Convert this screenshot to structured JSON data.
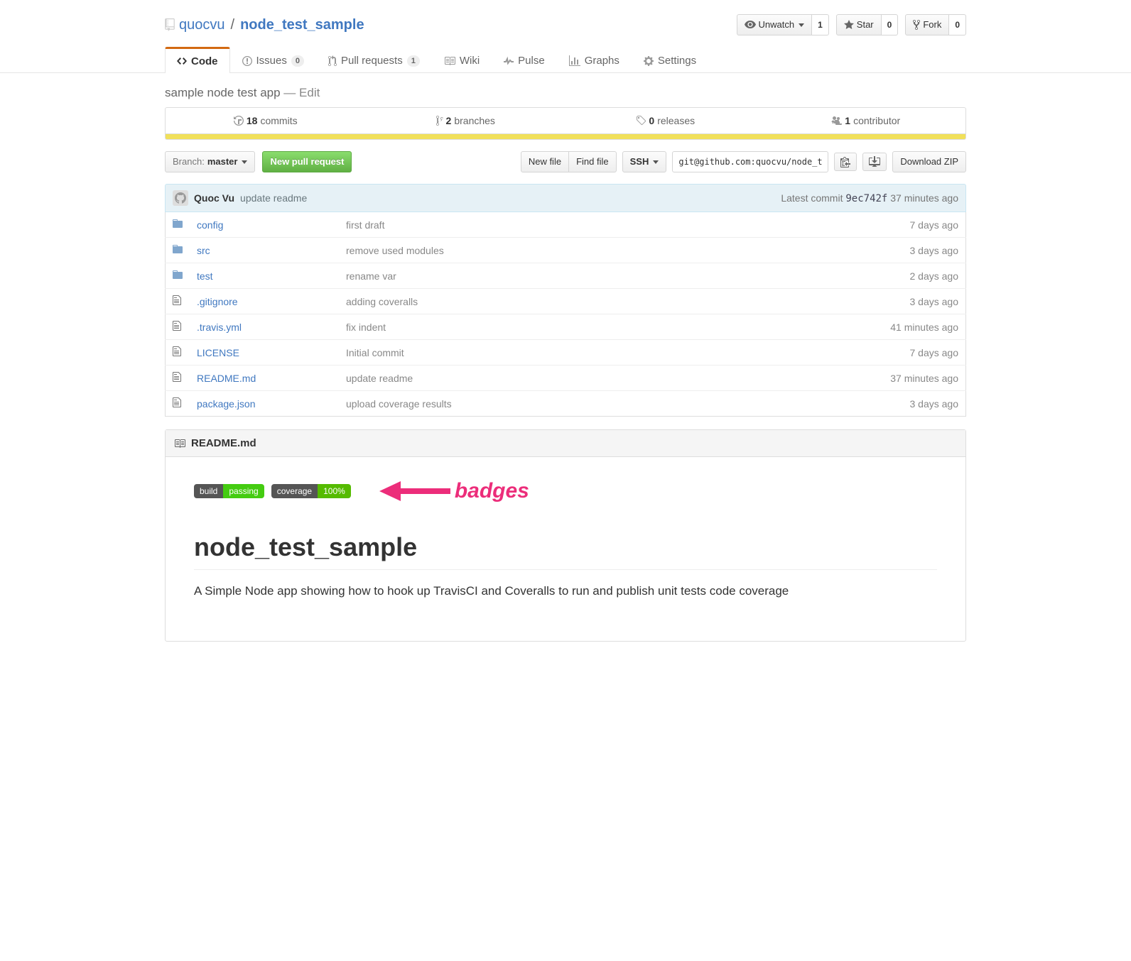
{
  "repo": {
    "owner": "quocvu",
    "name": "node_test_sample"
  },
  "actions": {
    "watch": {
      "label": "Unwatch",
      "count": "1"
    },
    "star": {
      "label": "Star",
      "count": "0"
    },
    "fork": {
      "label": "Fork",
      "count": "0"
    }
  },
  "tabs": {
    "code": "Code",
    "issues": {
      "label": "Issues",
      "count": "0"
    },
    "pulls": {
      "label": "Pull requests",
      "count": "1"
    },
    "wiki": "Wiki",
    "pulse": "Pulse",
    "graphs": "Graphs",
    "settings": "Settings"
  },
  "description": {
    "text": "sample node test app",
    "sep": "—",
    "edit": "Edit"
  },
  "stats": {
    "commits": {
      "num": "18",
      "label": "commits"
    },
    "branches": {
      "num": "2",
      "label": "branches"
    },
    "releases": {
      "num": "0",
      "label": "releases"
    },
    "contributors": {
      "num": "1",
      "label": "contributor"
    }
  },
  "fileNav": {
    "branchPrefix": "Branch:",
    "branchName": "master",
    "newPR": "New pull request",
    "newFile": "New file",
    "findFile": "Find file",
    "protocol": "SSH",
    "cloneUrl": "git@github.com:quocvu/node_t",
    "downloadZip": "Download ZIP"
  },
  "commitTease": {
    "author": "Quoc Vu",
    "message": "update readme",
    "latestLabel": "Latest commit",
    "sha": "9ec742f",
    "age": "37 minutes ago"
  },
  "files": [
    {
      "type": "dir",
      "name": "config",
      "message": "first draft",
      "age": "7 days ago"
    },
    {
      "type": "dir",
      "name": "src",
      "message": "remove used modules",
      "age": "3 days ago"
    },
    {
      "type": "dir",
      "name": "test",
      "message": "rename var",
      "age": "2 days ago"
    },
    {
      "type": "file",
      "name": ".gitignore",
      "message": "adding coveralls",
      "age": "3 days ago"
    },
    {
      "type": "file",
      "name": ".travis.yml",
      "message": "fix indent",
      "age": "41 minutes ago"
    },
    {
      "type": "file",
      "name": "LICENSE",
      "message": "Initial commit",
      "age": "7 days ago"
    },
    {
      "type": "file",
      "name": "README.md",
      "message": "update readme",
      "age": "37 minutes ago"
    },
    {
      "type": "file",
      "name": "package.json",
      "message": "upload coverage results",
      "age": "3 days ago"
    }
  ],
  "readme": {
    "filename": "README.md",
    "badges": {
      "build": {
        "key": "build",
        "value": "passing"
      },
      "coverage": {
        "key": "coverage",
        "value": "100%"
      }
    },
    "annotation": "badges",
    "heading": "node_test_sample",
    "paragraph": "A Simple Node app showing how to hook up TravisCI and Coveralls to run and publish unit tests code coverage"
  }
}
